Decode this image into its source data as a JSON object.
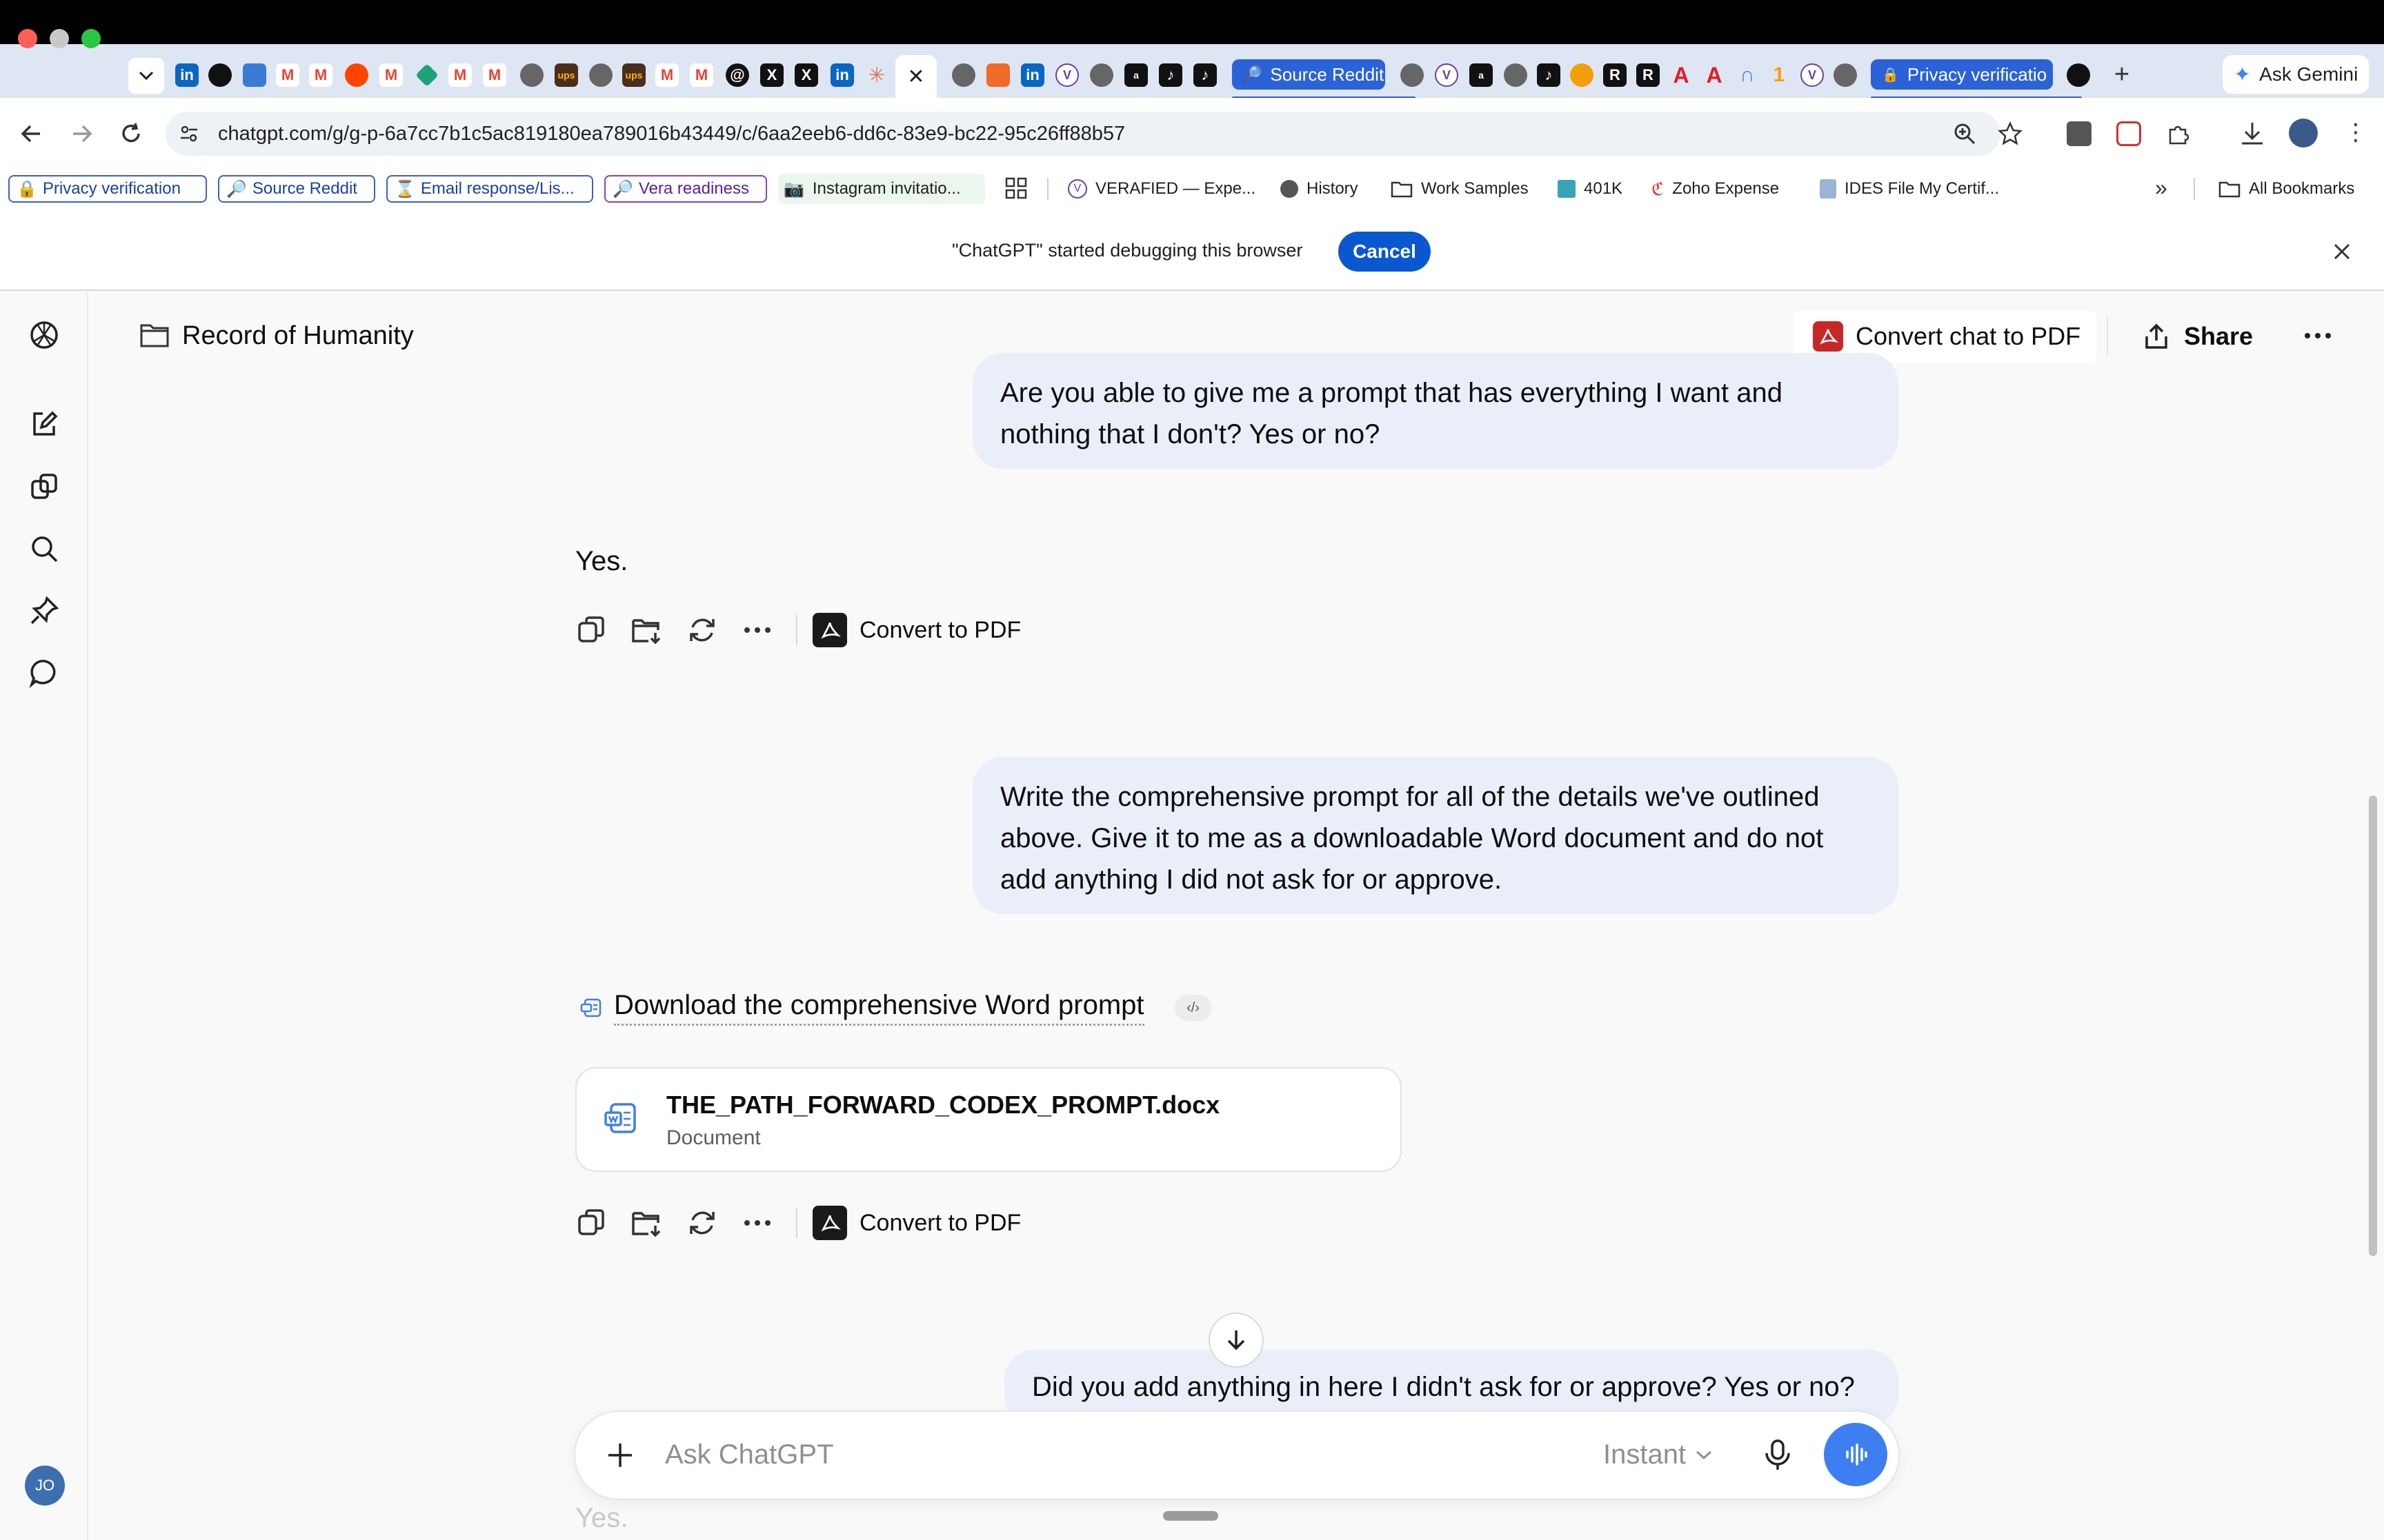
{
  "browser": {
    "tabs": {
      "pinned_tab_1_label": "Source Reddit",
      "pinned_tab_2_label": "Privacy verificatio"
    },
    "ask_gemini": "Ask Gemini",
    "url": "chatgpt.com/g/g-p-6a7cc7b1c5ac819180ea789016b43449/c/6aa2eeb6-dd6c-83e9-bc22-95c26ff88b57",
    "bookmarks": [
      "Privacy verification",
      "Source Reddit",
      "Email response/Lis...",
      "Vera readiness",
      "Instagram invitatio...",
      "VERAFIED — Expe...",
      "History",
      "Work Samples",
      "401K",
      "Zoho Expense",
      "IDES File My Certif..."
    ],
    "all_bookmarks": "All Bookmarks",
    "overflow": "»"
  },
  "banner": {
    "text": "\"ChatGPT\" started debugging this browser",
    "cancel": "Cancel"
  },
  "header": {
    "project_title": "Record of Humanity",
    "convert_chat_pdf": "Convert chat to PDF",
    "share": "Share"
  },
  "messages": {
    "user_1": "Are you able to give me a prompt that has everything I want and nothing that I don't? Yes or no?",
    "assistant_1": "Yes.",
    "convert_pdf": "Convert to PDF",
    "user_2": "Write the comprehensive prompt for all of the details we've outlined above. Give it to me as a downloadable Word document and do not add anything I did not ask for or approve.",
    "download_link": "Download the comprehensive Word prompt",
    "file_name": "THE_PATH_FORWARD_CODEX_PROMPT.docx",
    "file_type": "Document",
    "user_3": "Did you add anything in here I didn't ask for or approve? Yes or no?",
    "assistant_3_partial": "Yes."
  },
  "composer": {
    "placeholder": "Ask ChatGPT",
    "model": "Instant"
  },
  "avatar_initials": "JO",
  "colors": {
    "accent_blue": "#0b57d0",
    "user_bubble": "#e9eef8",
    "voice_button": "#3d7ff0"
  }
}
